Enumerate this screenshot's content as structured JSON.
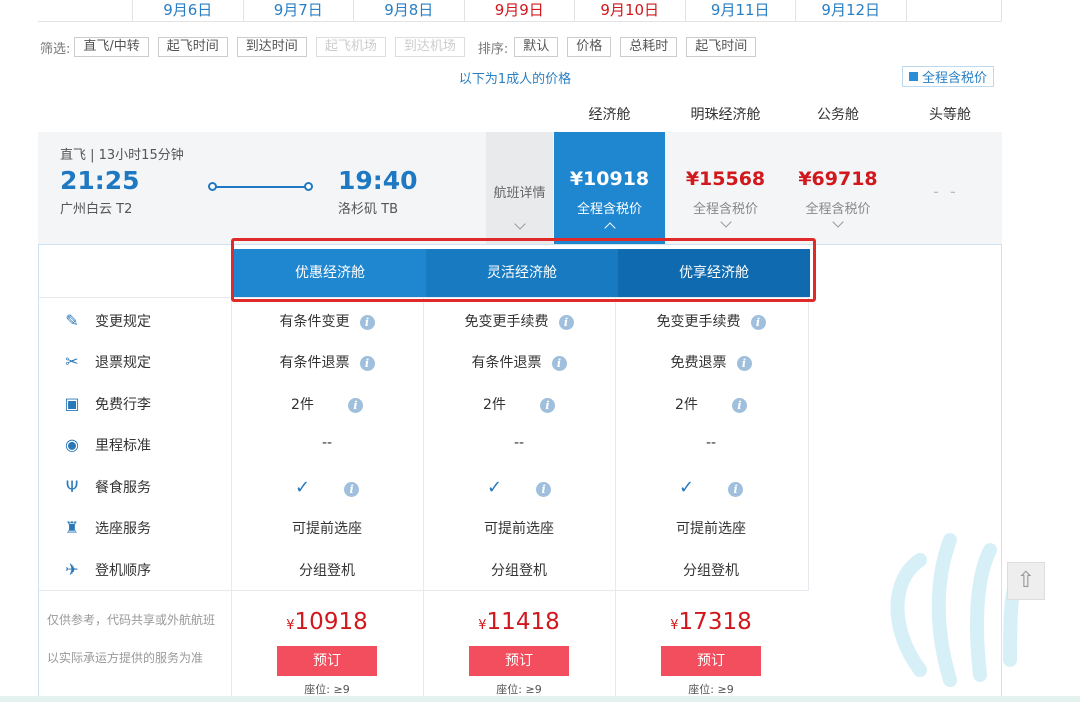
{
  "dates": [
    {
      "label": "9月6日",
      "highlight": false
    },
    {
      "label": "9月7日",
      "highlight": false
    },
    {
      "label": "9月8日",
      "highlight": false
    },
    {
      "label": "9月9日",
      "highlight": true
    },
    {
      "label": "9月10日",
      "highlight": true
    },
    {
      "label": "9月11日",
      "highlight": false
    },
    {
      "label": "9月12日",
      "highlight": false
    }
  ],
  "filters": {
    "filter_label": "筛选:",
    "filter_buttons": [
      {
        "label": "直飞/中转",
        "disabled": false
      },
      {
        "label": "起飞时间",
        "disabled": false
      },
      {
        "label": "到达时间",
        "disabled": false
      },
      {
        "label": "起飞机场",
        "disabled": true
      },
      {
        "label": "到达机场",
        "disabled": true
      }
    ],
    "sort_label": "排序:",
    "sort_buttons": [
      "默认",
      "价格",
      "总耗时",
      "起飞时间"
    ]
  },
  "adult_note": "以下为1成人的价格",
  "tax_toggle": "全程含税价",
  "cabins": [
    "经济舱",
    "明珠经济舱",
    "公务舱",
    "头等舱"
  ],
  "flight": {
    "meta": "直飞 | 13小时15分钟",
    "dep_time": "21:25",
    "dep_port": "广州白云 T2",
    "arr_time": "19:40",
    "arr_port": "洛杉矶 TB",
    "detail_label": "航班详情",
    "prices": [
      {
        "price": "¥10918",
        "sub": "全程含税价",
        "active": true
      },
      {
        "price": "¥15568",
        "sub": "全程含税价",
        "active": false
      },
      {
        "price": "¥69718",
        "sub": "全程含税价",
        "active": false
      }
    ],
    "first_class": "- -"
  },
  "sub_tabs": [
    "优惠经济舱",
    "灵活经济舱",
    "优享经济舱"
  ],
  "rules": [
    {
      "label": "变更规定",
      "icon": "✎",
      "values": [
        "有条件变更",
        "免变更手续费",
        "免变更手续费"
      ],
      "info": true
    },
    {
      "label": "退票规定",
      "icon": "✂",
      "values": [
        "有条件退票",
        "有条件退票",
        "免费退票"
      ],
      "info": true
    },
    {
      "label": "免费行李",
      "icon": "▣",
      "values": [
        "2件",
        "2件",
        "2件"
      ],
      "info": true
    },
    {
      "label": "里程标准",
      "icon": "◉",
      "values": [
        "--",
        "--",
        "--"
      ],
      "info": false
    },
    {
      "label": "餐食服务",
      "icon": "Ψ",
      "values": [
        "✓",
        "✓",
        "✓"
      ],
      "info": true
    },
    {
      "label": "选座服务",
      "icon": "♜",
      "values": [
        "可提前选座",
        "可提前选座",
        "可提前选座"
      ],
      "info": false
    },
    {
      "label": "登机顺序",
      "icon": "✈",
      "values": [
        "分组登机",
        "分组登机",
        "分组登机"
      ],
      "info": false
    }
  ],
  "foot_notes": [
    "仅供参考，代码共享或外航航班",
    "以实际承运方提供的服务为准"
  ],
  "fares": [
    {
      "currency": "¥",
      "amount": "10918",
      "book": "预订",
      "seats": "座位: ≥9"
    },
    {
      "currency": "¥",
      "amount": "11418",
      "book": "预订",
      "seats": "座位: ≥9"
    },
    {
      "currency": "¥",
      "amount": "17318",
      "book": "预订",
      "seats": "座位: ≥9"
    }
  ],
  "to_top_icon": "⇧"
}
